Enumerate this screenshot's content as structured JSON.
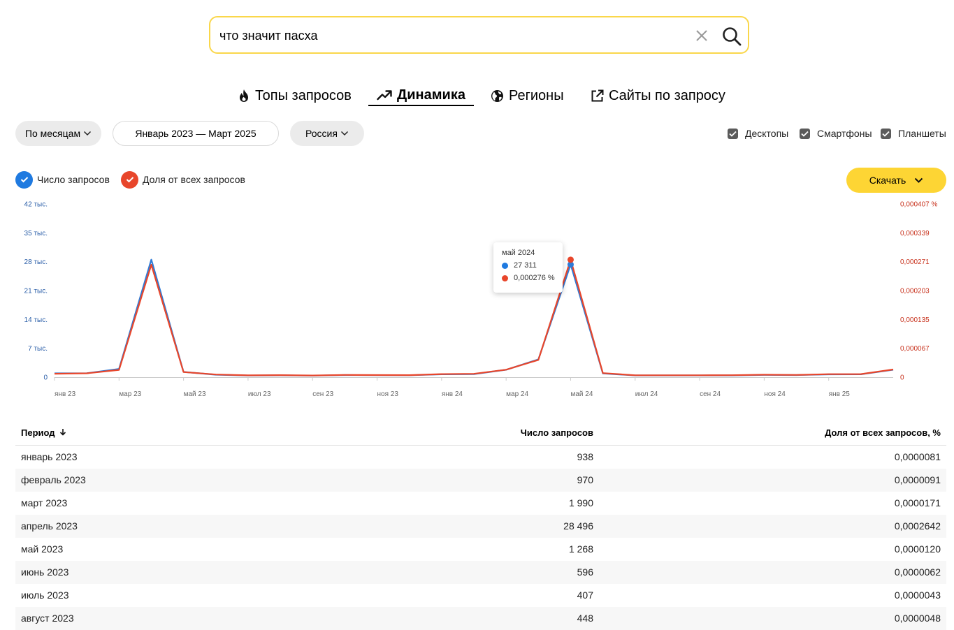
{
  "search": {
    "value": "что значит пасха"
  },
  "tabs": [
    {
      "label": "Топы запросов",
      "icon": "fire-icon"
    },
    {
      "label": "Динамика",
      "icon": "trend-icon",
      "active": true
    },
    {
      "label": "Регионы",
      "icon": "globe-icon"
    },
    {
      "label": "Сайты по запросу",
      "icon": "external-link-icon"
    }
  ],
  "filters": {
    "period": "По месяцам",
    "date_range": "Январь 2023 — Март 2025",
    "region": "Россия"
  },
  "devices": [
    {
      "label": "Десктопы",
      "checked": true
    },
    {
      "label": "Смартфоны",
      "checked": true
    },
    {
      "label": "Планшеты",
      "checked": true
    }
  ],
  "legend": [
    {
      "label": "Число запросов",
      "color": "#1f7ae0",
      "checked": true
    },
    {
      "label": "Доля от всех запросов",
      "color": "#e8462b",
      "checked": true
    }
  ],
  "download_label": "Скачать",
  "tooltip": {
    "title": "май 2024",
    "count": "27 311",
    "share": "0,000276 %"
  },
  "chart_data": {
    "type": "line",
    "x": [
      "янв 23",
      "фев 23",
      "мар 23",
      "апр 23",
      "май 23",
      "июн 23",
      "июл 23",
      "авг 23",
      "сен 23",
      "окт 23",
      "ноя 23",
      "дек 23",
      "янв 24",
      "фев 24",
      "мар 24",
      "апр 24",
      "май 24",
      "июн 24",
      "июл 24",
      "авг 24",
      "сен 24",
      "окт 24",
      "ноя 24",
      "дек 24",
      "янв 25",
      "фев 25",
      "мар 25"
    ],
    "x_tick_labels": [
      "янв 23",
      "мар 23",
      "май 23",
      "июл 23",
      "сен 23",
      "ноя 23",
      "янв 24",
      "мар 24",
      "май 24",
      "июл 24",
      "сен 24",
      "ноя 24",
      "янв 25"
    ],
    "y_left_ticks": [
      "0",
      "7 тыс.",
      "14 тыс.",
      "21 тыс.",
      "28 тыс.",
      "35 тыс.",
      "42 тыс."
    ],
    "y_right_ticks": [
      "0",
      "0,000067",
      "0,000135",
      "0,000203",
      "0,000271",
      "0,000339",
      "0,000407 %"
    ],
    "ylim_left": [
      0,
      42000
    ],
    "ylim_right": [
      0,
      0.000407
    ],
    "series": [
      {
        "name": "Число запросов",
        "axis": "left",
        "color": "#2f7bd6",
        "values": [
          938,
          970,
          1990,
          28496,
          1268,
          596,
          407,
          448,
          380,
          500,
          480,
          450,
          700,
          750,
          1800,
          4300,
          27311,
          900,
          420,
          420,
          420,
          430,
          550,
          500,
          680,
          700,
          1800
        ]
      },
      {
        "name": "Доля от всех запросов",
        "axis": "right",
        "color": "#e8462b",
        "values": [
          8.1e-06,
          9.1e-06,
          1.71e-05,
          0.0002642,
          1.2e-05,
          6.2e-06,
          4.3e-06,
          4.8e-06,
          4e-06,
          5.2e-06,
          5e-06,
          4.7e-06,
          7.2e-06,
          7.8e-06,
          1.75e-05,
          4.05e-05,
          0.000276,
          9.5e-06,
          4.5e-06,
          4.5e-06,
          4.5e-06,
          4.6e-06,
          5.8e-06,
          5.3e-06,
          7e-06,
          7.2e-06,
          1.8e-05
        ]
      }
    ],
    "highlight_index": 16
  },
  "table": {
    "headers": [
      "Период",
      "Число запросов",
      "Доля от всех запросов, %"
    ],
    "rows": [
      [
        "январь 2023",
        "938",
        "0,0000081"
      ],
      [
        "февраль 2023",
        "970",
        "0,0000091"
      ],
      [
        "март 2023",
        "1 990",
        "0,0000171"
      ],
      [
        "апрель 2023",
        "28 496",
        "0,0002642"
      ],
      [
        "май 2023",
        "1 268",
        "0,0000120"
      ],
      [
        "июнь 2023",
        "596",
        "0,0000062"
      ],
      [
        "июль 2023",
        "407",
        "0,0000043"
      ],
      [
        "август 2023",
        "448",
        "0,0000048"
      ]
    ]
  }
}
